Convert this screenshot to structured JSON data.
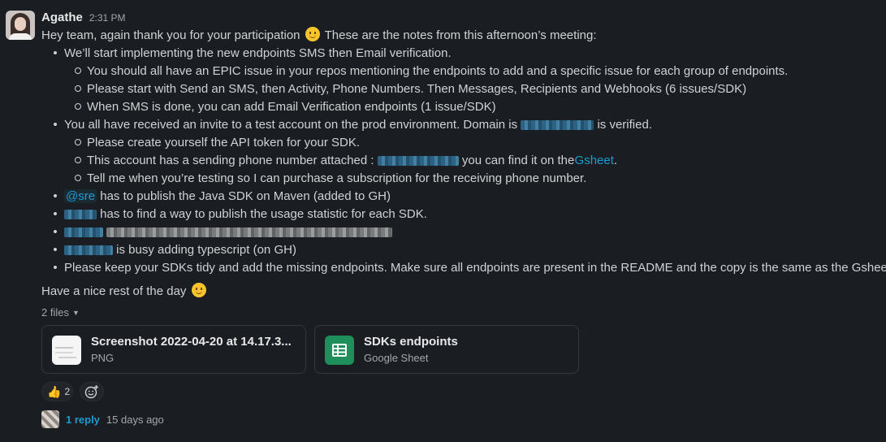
{
  "message": {
    "author": "Agathe",
    "time": "2:31 PM",
    "intro_before": "Hey team, again thank you for your participation",
    "intro_after": "These are the notes from this afternoon’s meeting:",
    "b1": "We’ll start implementing the new endpoints SMS then Email verification.",
    "b1_1": "You should all have an EPIC issue in your repos mentioning the endpoints to add and a specific issue for each group of endpoints.",
    "b1_2": "Please start with Send an SMS, then Activity, Phone Numbers. Then Messages, Recipients and Webhooks (6 issues/SDK)",
    "b1_3": "When SMS is done, you can add Email Verification endpoints (1 issue/SDK)",
    "b2_before": "You all have received an invite to a test account on the prod environment. Domain is",
    "b2_after": "is verified.",
    "b2_1": "Please create yourself the API token for your SDK.",
    "b2_2_before": "This account has a sending phone number attached :",
    "b2_2_mid": "you can find it on the",
    "b2_2_link": "Gsheet",
    "b2_2_end": ".",
    "b2_3": "Tell me when you’re testing so I can purchase a subscription for the receiving phone number.",
    "b3_mention": "@sre",
    "b3_text": "has to publish the Java SDK on Maven (added to GH)",
    "b4_text": "has to find a way to publish the usage statistic for each SDK.",
    "b6_text": "is busy adding typescript (on GH)",
    "b7": "Please keep your SDKs tidy and add the missing endpoints. Make sure all endpoints are present in the README and the copy is the same as the Gsheet.",
    "closing": "Have a nice rest of the day"
  },
  "files": {
    "toggle_label": "2 files",
    "items": [
      {
        "name": "Screenshot 2022-04-20 at 14.17.3...",
        "type": "PNG"
      },
      {
        "name": "SDKs endpoints",
        "type": "Google Sheet"
      }
    ]
  },
  "reactions": {
    "thumbs_up_count": "2"
  },
  "thread": {
    "reply_label": "1 reply",
    "last_reply": "15 days ago"
  },
  "icons": {
    "smile": "slightly-smiling-emoji",
    "thumbs": "thumbs-up-emoji",
    "add": "add-reaction-icon",
    "caret": "caret-down-icon"
  },
  "colors": {
    "background": "#1a1d21",
    "link": "#1d9bd1",
    "text": "#d1d2d3",
    "sheet_icon": "#1e8e5a"
  }
}
